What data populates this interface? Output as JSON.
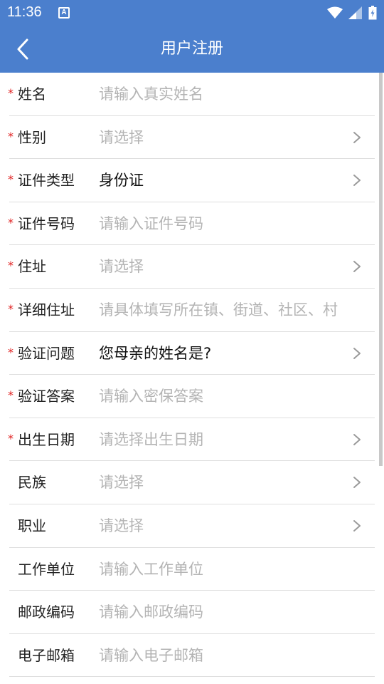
{
  "status_bar": {
    "time": "11:36",
    "notification_icon": "A"
  },
  "header": {
    "title": "用户注册"
  },
  "form": [
    {
      "label": "姓名",
      "value": "请输入真实姓名",
      "required": true,
      "chevron": false,
      "filled": false
    },
    {
      "label": "性别",
      "value": "请选择",
      "required": true,
      "chevron": true,
      "filled": false
    },
    {
      "label": "证件类型",
      "value": "身份证",
      "required": true,
      "chevron": true,
      "filled": true
    },
    {
      "label": "证件号码",
      "value": "请输入证件号码",
      "required": true,
      "chevron": false,
      "filled": false
    },
    {
      "label": "住址",
      "value": "请选择",
      "required": true,
      "chevron": true,
      "filled": false
    },
    {
      "label": "详细住址",
      "value": "请具体填写所在镇、街道、社区、村",
      "required": true,
      "chevron": false,
      "filled": false
    },
    {
      "label": "验证问题",
      "value": "您母亲的姓名是?",
      "required": true,
      "chevron": true,
      "filled": true
    },
    {
      "label": "验证答案",
      "value": "请输入密保答案",
      "required": true,
      "chevron": false,
      "filled": false
    },
    {
      "label": "出生日期",
      "value": "请选择出生日期",
      "required": true,
      "chevron": true,
      "filled": false
    },
    {
      "label": "民族",
      "value": "请选择",
      "required": false,
      "chevron": true,
      "filled": false
    },
    {
      "label": "职业",
      "value": "请选择",
      "required": false,
      "chevron": true,
      "filled": false
    },
    {
      "label": "工作单位",
      "value": "请输入工作单位",
      "required": false,
      "chevron": false,
      "filled": false
    },
    {
      "label": "邮政编码",
      "value": "请输入邮政编码",
      "required": false,
      "chevron": false,
      "filled": false
    },
    {
      "label": "电子邮箱",
      "value": "请输入电子邮箱",
      "required": false,
      "chevron": false,
      "filled": false
    }
  ],
  "required_mark": "*",
  "colors": {
    "primary": "#4b7fcd",
    "required": "#e02020",
    "placeholder": "#b4b4b4"
  },
  "icons": {
    "back": "back-arrow-icon",
    "chevron": "chevron-right-icon",
    "wifi": "wifi-icon",
    "signal": "signal-icon",
    "battery": "battery-icon"
  }
}
